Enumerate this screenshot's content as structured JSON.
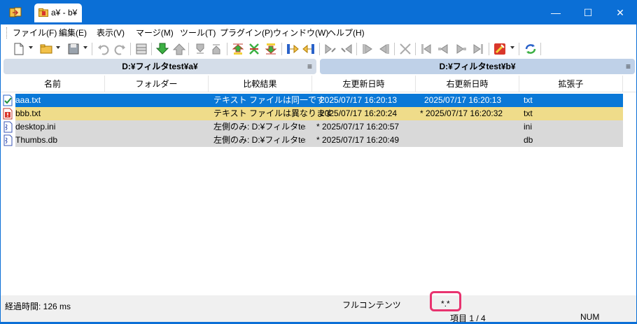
{
  "window": {
    "tab_title": "a¥ - b¥",
    "minimize": "—",
    "maximize": "☐",
    "close": "✕"
  },
  "menu": {
    "items": [
      "ファイル(F)",
      "編集(E)",
      "表示(V)",
      "マージ(M)",
      "ツール(T)",
      "プラグイン(P)",
      "ウィンドウ(W)",
      "ヘルプ(H)"
    ]
  },
  "paths": {
    "left": "D:¥フィルタtest¥a¥",
    "right": "D:¥フィルタtest¥b¥",
    "menu_glyph": "≡"
  },
  "columns": [
    "名前",
    "フォルダー",
    "比較結果",
    "左更新日時",
    "右更新日時",
    "拡張子"
  ],
  "rows": [
    {
      "name": "aaa.txt",
      "folder": "",
      "result": "テキスト ファイルは同一です",
      "left_date": "2025/07/17 16:20:13",
      "right_date": "2025/07/17 16:20:13",
      "ext": "txt",
      "state": "selected",
      "icon": "identical-file-icon"
    },
    {
      "name": "bbb.txt",
      "folder": "",
      "result": "テキスト ファイルは異なります",
      "left_date": "2025/07/17 16:20:24",
      "right_date": "* 2025/07/17 16:20:32",
      "ext": "txt",
      "state": "different",
      "icon": "different-file-icon"
    },
    {
      "name": "desktop.ini",
      "folder": "",
      "result": "左側のみ: D:¥フィルタtest¥a",
      "left_date": "* 2025/07/17 16:20:57",
      "right_date": "",
      "ext": "ini",
      "state": "left-only",
      "icon": "left-only-file-icon"
    },
    {
      "name": "Thumbs.db",
      "folder": "",
      "result": "左側のみ: D:¥フィルタtest¥a",
      "left_date": "* 2025/07/17 16:20:49",
      "right_date": "",
      "ext": "db",
      "state": "left-only",
      "icon": "left-only-file-icon"
    }
  ],
  "status": {
    "elapsed": "経過時間: 126 ms",
    "compare_method": "フルコンテンツ",
    "filter": "*.*",
    "items": "項目 1 / 4",
    "num": "NUM"
  },
  "colors": {
    "titlebar": "#0b6fd6",
    "selected_row": "#0a78d7",
    "different_row": "#efdc8a",
    "left_only_row": "#d9d9d9",
    "highlight_box": "#e8336f"
  }
}
